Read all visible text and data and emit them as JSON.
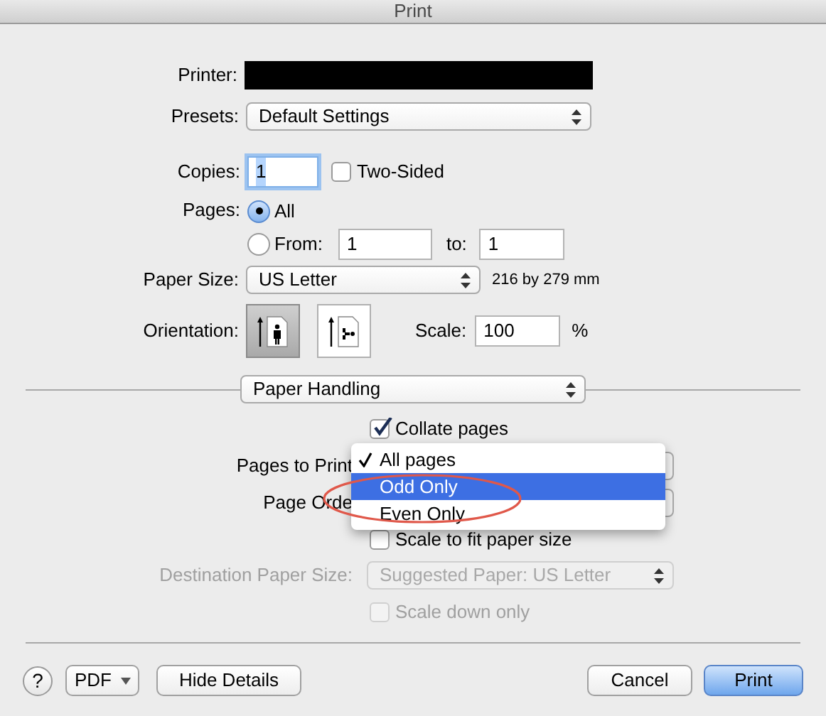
{
  "window": {
    "title": "Print"
  },
  "printer": {
    "label": "Printer:"
  },
  "presets": {
    "label": "Presets:",
    "value": "Default Settings"
  },
  "copies": {
    "label": "Copies:",
    "value": "1",
    "two_sided": {
      "label": "Two-Sided",
      "checked": false
    }
  },
  "pages": {
    "label": "Pages:",
    "options": [
      {
        "label": "All",
        "selected": true
      },
      {
        "label": "From:",
        "selected": false
      }
    ],
    "from_value": "1",
    "to_label": "to:",
    "to_value": "1"
  },
  "paper_size": {
    "label": "Paper Size:",
    "value": "US Letter",
    "dimensions": "216 by 279 mm"
  },
  "orientation": {
    "label": "Orientation:",
    "options": [
      {
        "kind": "portrait",
        "selected": true
      },
      {
        "kind": "landscape",
        "selected": false
      }
    ]
  },
  "scale": {
    "label": "Scale:",
    "value": "100",
    "unit": "%"
  },
  "section": {
    "value": "Paper Handling"
  },
  "collate": {
    "label": "Collate pages",
    "checked": true,
    "disabled": false
  },
  "pages_to_print": {
    "label": "Pages to Print"
  },
  "page_order": {
    "label": "Page Orde"
  },
  "scale_to_fit": {
    "label": "Scale to fit paper size",
    "checked": false,
    "disabled": false
  },
  "destination": {
    "label": "Destination Paper Size:",
    "value": "Suggested Paper: US Letter",
    "disabled": true
  },
  "scale_down": {
    "label": "Scale down only",
    "checked": false,
    "disabled": true
  },
  "menu": {
    "items": [
      {
        "label": "All pages",
        "checked": true,
        "selected": false
      },
      {
        "label": "Odd Only",
        "checked": false,
        "selected": true
      },
      {
        "label": "Even Only",
        "checked": false,
        "selected": false
      }
    ]
  },
  "buttons": {
    "help": "?",
    "pdf": "PDF",
    "hide_details": "Hide Details",
    "cancel": "Cancel",
    "print": "Print"
  }
}
